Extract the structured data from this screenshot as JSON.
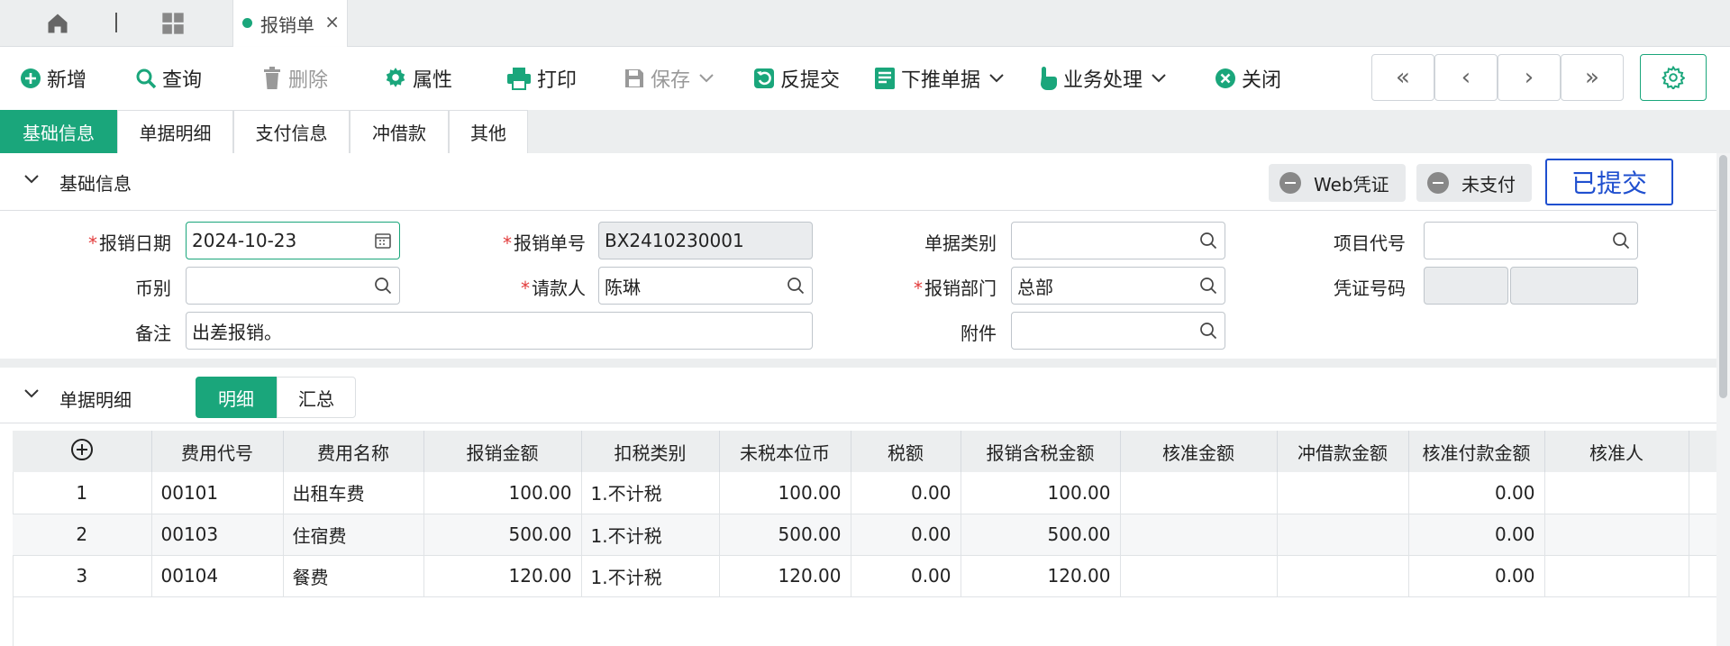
{
  "tabstrip": {
    "doc_tab_label": "报销单",
    "close_glyph": "×",
    "home_icon": "home-icon",
    "grid_icon": "apps-grid-icon"
  },
  "toolbar": {
    "new": "新增",
    "query": "查询",
    "delete": "删除",
    "properties": "属性",
    "print": "打印",
    "save": "保存",
    "unsubmit": "反提交",
    "push_down": "下推单据",
    "business": "业务处理",
    "close": "关闭",
    "nav": {
      "first": "«",
      "prev": "‹",
      "next": "›",
      "last": "»"
    }
  },
  "section_tabs": [
    "基础信息",
    "单据明细",
    "支付信息",
    "冲借款",
    "其他"
  ],
  "basic": {
    "title": "基础信息",
    "web_voucher": "Web凭证",
    "payment_status": "未支付",
    "doc_status": "已提交",
    "fields": {
      "date_label": "报销日期",
      "date_value": "2024-10-23",
      "docno_label": "报销单号",
      "docno_value": "BX2410230001",
      "doctype_label": "单据类别",
      "doctype_value": "",
      "project_label": "项目代号",
      "project_value": "",
      "currency_label": "币别",
      "currency_value": "",
      "requester_label": "请款人",
      "requester_value": "陈琳",
      "dept_label": "报销部门",
      "dept_value": "总部",
      "voucher_label": "凭证号码",
      "remark_label": "备注",
      "remark_value": "出差报销。",
      "attach_label": "附件",
      "attach_value": ""
    }
  },
  "detail": {
    "title": "单据明细",
    "view_detail": "明细",
    "view_summary": "汇总",
    "columns": [
      "费用代号",
      "费用名称",
      "报销金额",
      "扣税类别",
      "未税本位币",
      "税额",
      "报销含税金额",
      "核准金额",
      "冲借款金额",
      "核准付款金额",
      "核准人"
    ],
    "rows": [
      {
        "no": "1",
        "code": "00101",
        "name": "出租车费",
        "amount": "100.00",
        "tax_type": "1.不计税",
        "pretax": "100.00",
        "tax": "0.00",
        "incl": "100.00",
        "approved": "",
        "offset": "",
        "approved_pay": "0.00",
        "approver": ""
      },
      {
        "no": "2",
        "code": "00103",
        "name": "住宿费",
        "amount": "500.00",
        "tax_type": "1.不计税",
        "pretax": "500.00",
        "tax": "0.00",
        "incl": "500.00",
        "approved": "",
        "offset": "",
        "approved_pay": "0.00",
        "approver": ""
      },
      {
        "no": "3",
        "code": "00104",
        "name": "餐费",
        "amount": "120.00",
        "tax_type": "1.不计税",
        "pretax": "120.00",
        "tax": "0.00",
        "incl": "120.00",
        "approved": "",
        "offset": "",
        "approved_pay": "0.00",
        "approver": ""
      }
    ]
  },
  "colors": {
    "accent": "#1aa67b",
    "status_blue": "#1f4fcf",
    "required": "#e23b3b"
  }
}
